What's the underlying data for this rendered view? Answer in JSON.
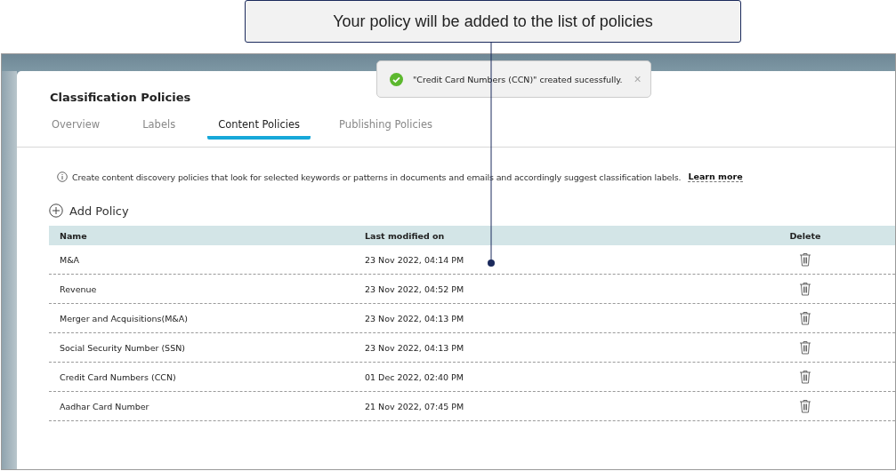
{
  "callout": {
    "text": "Your policy will be added to the list of policies"
  },
  "toast": {
    "message": "\"Credit Card Numbers (CCN)\" created sucessfully.",
    "close": "×"
  },
  "page": {
    "title": "Classification Policies"
  },
  "tabs": [
    {
      "label": "Overview",
      "selected": false
    },
    {
      "label": "Labels",
      "selected": false
    },
    {
      "label": "Content Policies",
      "selected": true
    },
    {
      "label": "Publishing Policies",
      "selected": false
    }
  ],
  "info": {
    "text": "Create content discovery policies that look for selected keywords or patterns in documents and emails and accordingly suggest classification labels.",
    "link": "Learn more"
  },
  "add_button": "Add Policy",
  "table": {
    "columns": [
      "Name",
      "Last modified on",
      "Delete"
    ],
    "rows": [
      {
        "name": "M&A",
        "modified": "23 Nov 2022, 04:14 PM"
      },
      {
        "name": "Revenue",
        "modified": "23 Nov 2022, 04:52 PM"
      },
      {
        "name": "Merger and Acquisitions(M&A)",
        "modified": "23 Nov 2022, 04:13 PM"
      },
      {
        "name": "Social Security Number (SSN)",
        "modified": "23 Nov 2022, 04:13 PM"
      },
      {
        "name": "Credit Card Numbers (CCN)",
        "modified": "01 Dec 2022, 02:40 PM"
      },
      {
        "name": "Aadhar Card Number",
        "modified": "21 Nov 2022, 07:45 PM"
      }
    ]
  }
}
